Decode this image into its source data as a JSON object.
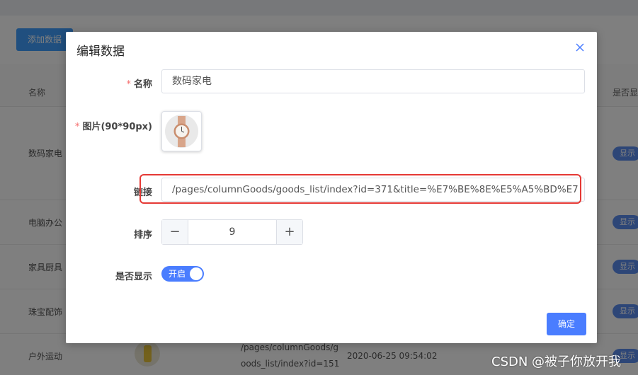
{
  "background": {
    "add_button": "添加数据",
    "col_name": "名称",
    "col_show": "是否显示",
    "rows": [
      {
        "name": "数码家电",
        "badge": "显示"
      },
      {
        "name": "电脑办公",
        "badge": "显示"
      },
      {
        "name": "家具厨具",
        "badge": "显示"
      },
      {
        "name": "珠宝配饰",
        "badge": "显示"
      },
      {
        "name": "户外运动",
        "badge": "显示"
      }
    ],
    "last_row_link_1": "/pages/columnGoods/g",
    "last_row_link_2": "oods_list/index?id=151",
    "last_row_date": "2020-06-25 09:54:02"
  },
  "dialog": {
    "title": "编辑数据",
    "name_label": "名称",
    "name_value": "数码家电",
    "image_label": "图片(90*90px)",
    "link_label": "链接",
    "link_value": "/pages/columnGoods/goods_list/index?id=371&title=%E7%BE%8E%E5%A5%BD%E7",
    "sort_label": "排序",
    "sort_minus": "−",
    "sort_plus": "+",
    "sort_value": "9",
    "show_label": "是否显示",
    "switch_text": "开启",
    "switch_on": true,
    "confirm_button": "确定"
  },
  "required_mark": "*",
  "watermark": "CSDN @被子你放开我",
  "colors": {
    "primary": "#4a7dff",
    "required": "#f56c6c",
    "highlight_border": "#e53935"
  }
}
